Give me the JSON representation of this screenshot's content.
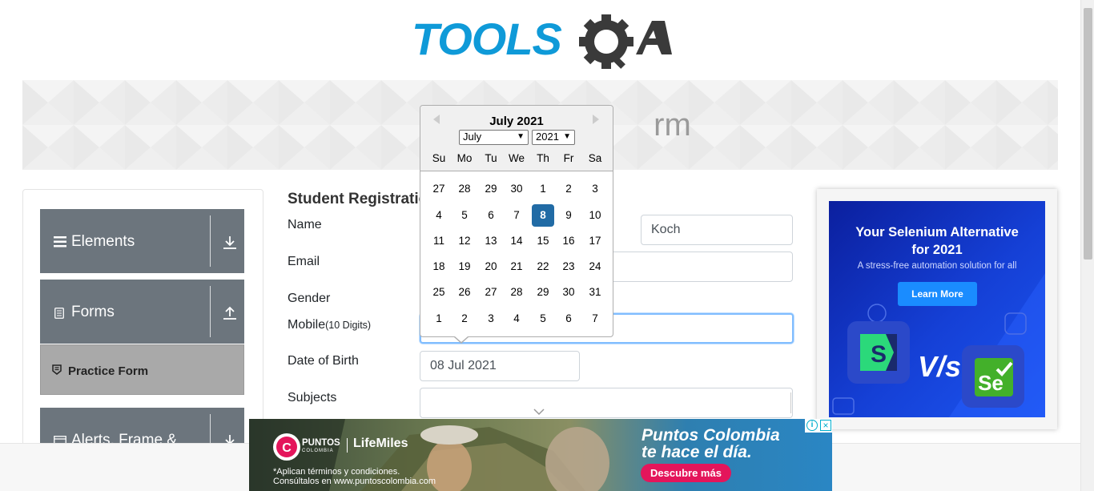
{
  "header": {
    "logo_text_primary": "TOOLS",
    "logo_text_secondary": "QA",
    "brand_color": "#0f9ad8",
    "logo_dark_color": "#3a3a3a"
  },
  "banner": {
    "title": "rm"
  },
  "sidebar": {
    "groups": [
      {
        "label": "Elements",
        "icon": "hamburger-icon",
        "arrow": "download-arrow-icon"
      },
      {
        "label": "Forms",
        "icon": "document-icon",
        "arrow": "upload-arrow-icon"
      },
      {
        "label": "Alerts, Frame &",
        "icon": "window-icon",
        "arrow": "download-arrow-icon"
      }
    ],
    "active_item": {
      "label": "Practice Form",
      "icon": "badge-icon"
    }
  },
  "form": {
    "title": "Student Registratio",
    "name_label": "Name",
    "last_name_value": "Koch",
    "email_label": "Email",
    "gender_label": "Gender",
    "mobile_label": "Mobile",
    "mobile_hint": "(10 Digits)",
    "dob_label": "Date of Birth",
    "dob_value": "08 Jul 2021",
    "subjects_label": "Subjects"
  },
  "datepicker": {
    "current_month": "July 2021",
    "month_select": "July",
    "year_select": "2021",
    "day_names": [
      "Su",
      "Mo",
      "Tu",
      "We",
      "Th",
      "Fr",
      "Sa"
    ],
    "weeks": [
      [
        "27",
        "28",
        "29",
        "30",
        "1",
        "2",
        "3"
      ],
      [
        "4",
        "5",
        "6",
        "7",
        "8",
        "9",
        "10"
      ],
      [
        "11",
        "12",
        "13",
        "14",
        "15",
        "16",
        "17"
      ],
      [
        "18",
        "19",
        "20",
        "21",
        "22",
        "23",
        "24"
      ],
      [
        "25",
        "26",
        "27",
        "28",
        "29",
        "30",
        "31"
      ],
      [
        "1",
        "2",
        "3",
        "4",
        "5",
        "6",
        "7"
      ]
    ],
    "selected_day": "8",
    "selected_color": "#216ba5"
  },
  "ad_right": {
    "headline_line1": "Your Selenium Alternative",
    "headline_line2": "for 2021",
    "subtext": "A stress-free automation solution for all",
    "button": "Learn More",
    "vs_text": "V/s"
  },
  "ad_bottom": {
    "brand": "PUNTOS",
    "brand_sub": "COLOMBIA",
    "partner": "LifeMiles",
    "slogan_line1": "Puntos Colombia",
    "slogan_line2": "te hace el día.",
    "cta": "Descubre más",
    "legal_line1": "*Aplican términos y condiciones.",
    "legal_line2": "Consúltalos en www.puntoscolombia.com",
    "cta_color": "#e4155b"
  }
}
